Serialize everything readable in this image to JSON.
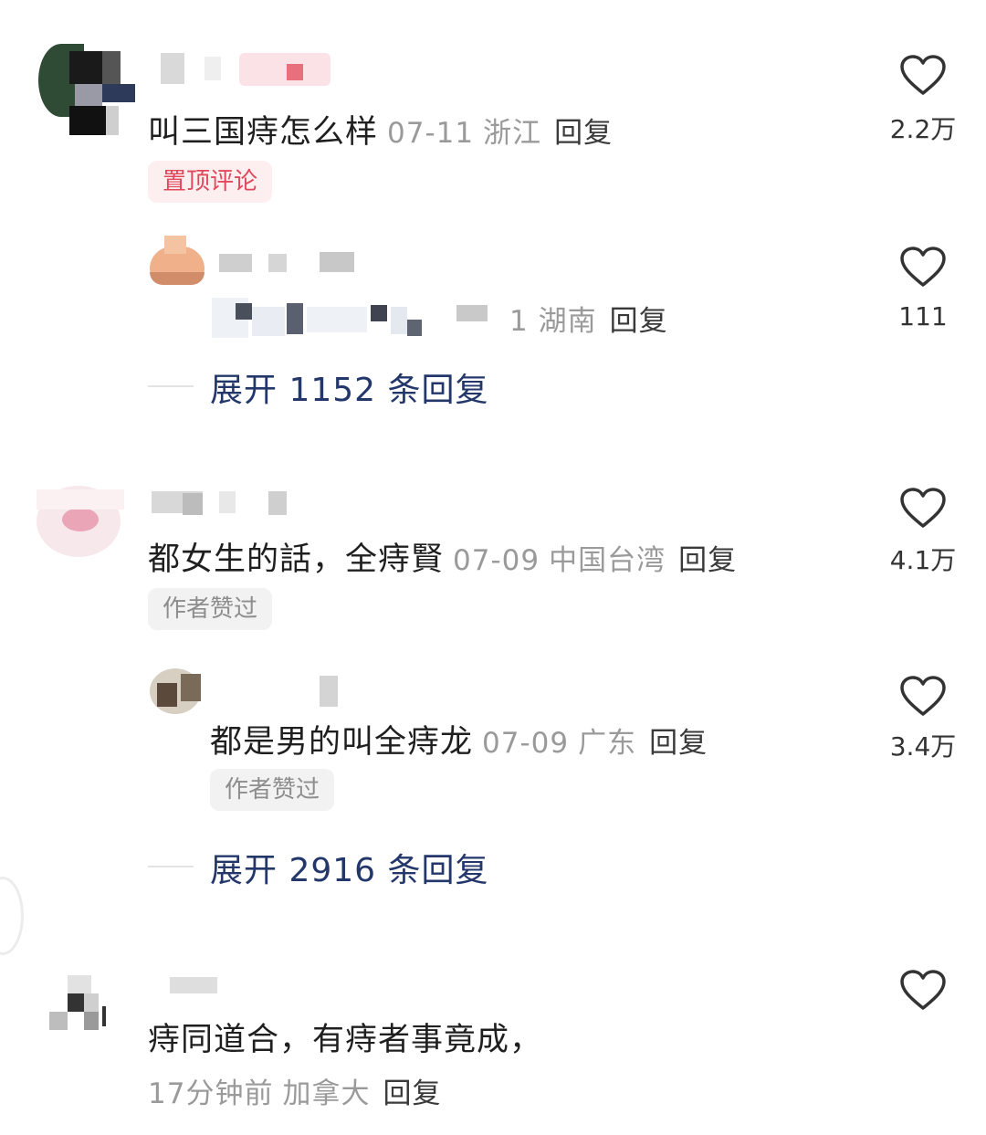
{
  "comments": [
    {
      "text": "叫三国痔怎么样",
      "date": "07-11",
      "location": "浙江",
      "reply_label": "回复",
      "badge": "置顶评论",
      "likes": "2.2万",
      "sub_reply": {
        "location_fragment": "1 湖南",
        "reply_label": "回复",
        "likes": "111"
      },
      "expand_label": "展开 1152 条回复"
    },
    {
      "text": "都女生的話，全痔賢",
      "date": "07-09",
      "location": "中国台湾",
      "reply_label": "回复",
      "badge": "作者赞过",
      "likes": "4.1万",
      "sub_reply": {
        "text": "都是男的叫全痔龙",
        "date": "07-09",
        "location": "广东",
        "reply_label": "回复",
        "badge": "作者赞过",
        "likes": "3.4万"
      },
      "expand_label": "展开 2916 条回复"
    },
    {
      "text": "痔同道合，有痔者事竟成，",
      "date": "17分钟前",
      "location": "加拿大",
      "reply_label": "回复"
    }
  ],
  "icons": {
    "like": "heart-outline-icon"
  },
  "colors": {
    "pinned_badge": "#e0485c",
    "expand_link": "#23376b",
    "meta": "#9a9a9a"
  }
}
